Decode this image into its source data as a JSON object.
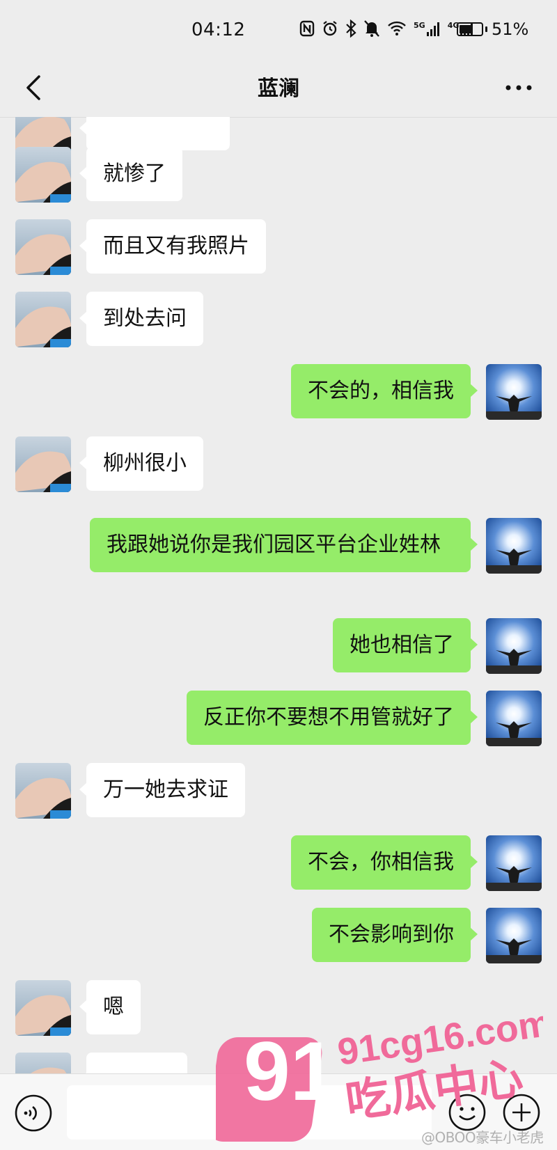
{
  "status_bar": {
    "time": "04:12",
    "network_5g": "5G",
    "network_4g": "4G",
    "battery_percent": "51%",
    "icons": [
      "nfc-icon",
      "alarm-icon",
      "bluetooth-icon",
      "mute-icon",
      "wifi-icon",
      "signal-5g-icon",
      "signal-4g-icon",
      "battery-icon"
    ]
  },
  "header": {
    "title": "蓝澜",
    "back_icon": "chevron-left-icon",
    "more_icon": "more-dots-icon"
  },
  "messages": [
    {
      "side": "left",
      "text": "就惨了"
    },
    {
      "side": "left",
      "text": "而且又有我照片"
    },
    {
      "side": "left",
      "text": "到处去问"
    },
    {
      "side": "right",
      "text": "不会的，相信我"
    },
    {
      "side": "left",
      "text": "柳州很小"
    },
    {
      "side": "right",
      "text": "我跟她说你是我们园区平台企业姓林"
    },
    {
      "side": "right",
      "text": "她也相信了"
    },
    {
      "side": "right",
      "text": "反正你不要想不用管就好了"
    },
    {
      "side": "left",
      "text": "万一她去求证"
    },
    {
      "side": "right",
      "text": "不会，你相信我"
    },
    {
      "side": "right",
      "text": "不会影响到你"
    },
    {
      "side": "left",
      "text": "嗯"
    }
  ],
  "input_bar": {
    "voice_icon": "voice-icon",
    "input_value": "",
    "emoji_icon": "emoji-icon",
    "plus_icon": "plus-icon"
  },
  "watermark": {
    "logo_number": "91",
    "site": "91cg16.com",
    "site_name": "吃瓜中心",
    "handle": "@OBOO豪车小老虎"
  },
  "colors": {
    "background": "#ededed",
    "sent_bubble": "#95ec69",
    "received_bubble": "#ffffff",
    "watermark_pink": "#f06a9a"
  }
}
